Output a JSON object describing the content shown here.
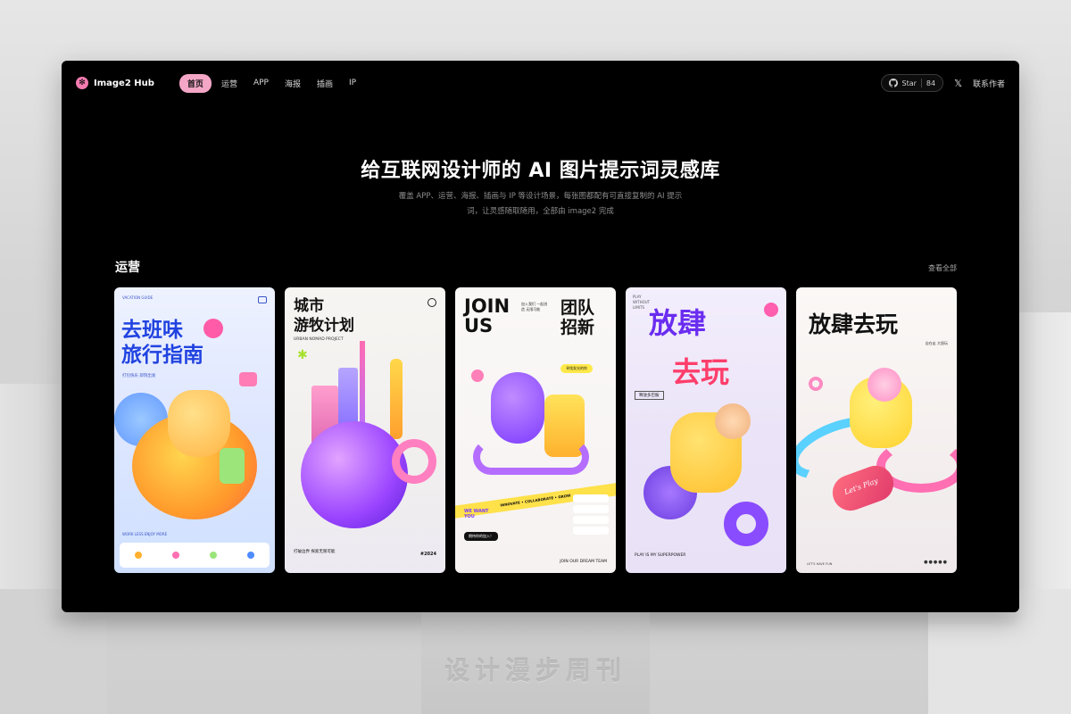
{
  "brand": {
    "name": "Image2 Hub",
    "logo_icon": "flower-icon"
  },
  "nav": {
    "items": [
      {
        "label": "首页",
        "active": true
      },
      {
        "label": "运营",
        "active": false
      },
      {
        "label": "APP",
        "active": false
      },
      {
        "label": "海报",
        "active": false
      },
      {
        "label": "插画",
        "active": false
      },
      {
        "label": "IP",
        "active": false
      }
    ],
    "star_label": "Star",
    "star_count": "84",
    "x_icon": "𝕏",
    "contact_label": "联系作者"
  },
  "hero": {
    "title": "给互联网设计师的 AI 图片提示词灵感库",
    "subtitle": "覆盖 APP、运营、海报、插画与 IP 等设计场景，每张图都配有可直接复制的 AI 提示词，让灵感随取随用，全部由 image2 完成"
  },
  "section": {
    "title": "运营",
    "view_all": "查看全部"
  },
  "cards": [
    {
      "title_line1": "去班味",
      "title_line2": "旅行指南",
      "small": "VACATION GUIDE",
      "sub": "打包快乐 即刻出发",
      "foot": "WORK LESS ENJOY MORE"
    },
    {
      "title_line1": "城市",
      "title_line2": "游牧计划",
      "sub": "URBAN NOMAD PROJECT",
      "foot": "打破边界 探索无限可能",
      "year": "#2024"
    },
    {
      "title": "JOIN US",
      "title_cn_line1": "团队",
      "title_cn_line2": "招新",
      "small": "加入我们 一起创造 无限可能",
      "tag": "寻找发光的你",
      "ribbon": "INNOVATE • COLLABORATE • GROW",
      "we": "WE WANT YOU",
      "button": "期待你的加入！",
      "foot": "JOIN OUR DREAM TEAM"
    },
    {
      "title_line1": "放肆",
      "title_line2": "去玩",
      "side": "PLAY WITHOUT LIMITS",
      "box": "释放多巴胺",
      "foot": "PLAY IS MY SUPERPOWER"
    },
    {
      "title": "放肆去玩",
      "sub": "自在走 大胆玩",
      "script": "Let's Play",
      "foot": "LET'S HAVE FUN",
      "dots": "●●●●●"
    }
  ],
  "stand_text": "设计漫步周刊",
  "colors": {
    "accent_pink": "#f3a6c6",
    "screen_bg": "#000000"
  }
}
